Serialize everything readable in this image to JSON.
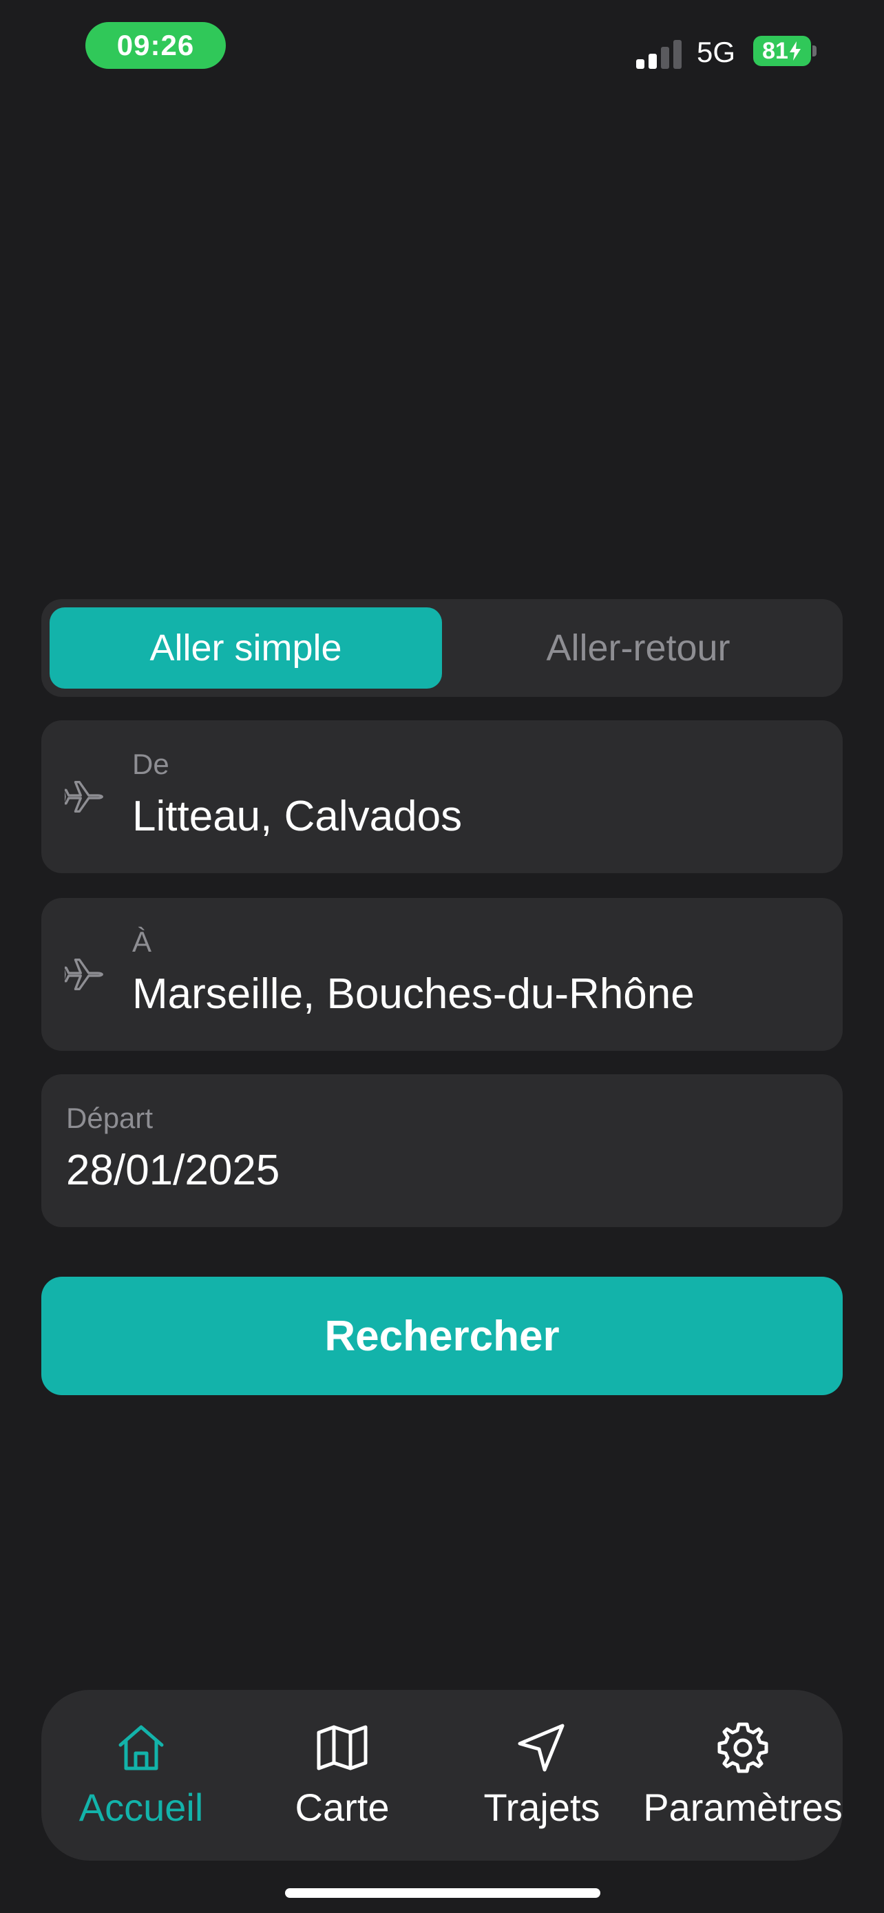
{
  "status_bar": {
    "time": "09:26",
    "network": "5G",
    "battery": "81"
  },
  "trip_type": {
    "options": [
      "Aller simple",
      "Aller-retour"
    ],
    "selected": "Aller simple"
  },
  "form": {
    "from": {
      "label": "De",
      "value": "Litteau, Calvados",
      "icon": "airplane-icon"
    },
    "to": {
      "label": "À",
      "value": "Marseille, Bouches-du-Rhône",
      "icon": "airplane-icon"
    },
    "departure": {
      "label": "Départ",
      "value": "28/01/2025"
    }
  },
  "search_button": {
    "label": "Rechercher"
  },
  "tab_bar": {
    "items": [
      {
        "label": "Accueil",
        "icon": "home-icon",
        "active": true
      },
      {
        "label": "Carte",
        "icon": "map-icon",
        "active": false
      },
      {
        "label": "Trajets",
        "icon": "navigation-arrow-icon",
        "active": false
      },
      {
        "label": "Paramètres",
        "icon": "gear-icon",
        "active": false
      }
    ]
  },
  "colors": {
    "background": "#1c1c1e",
    "surface": "#2c2c2e",
    "accent": "#13b3aa",
    "status_green": "#30c859",
    "muted_text": "#8e8e93"
  }
}
